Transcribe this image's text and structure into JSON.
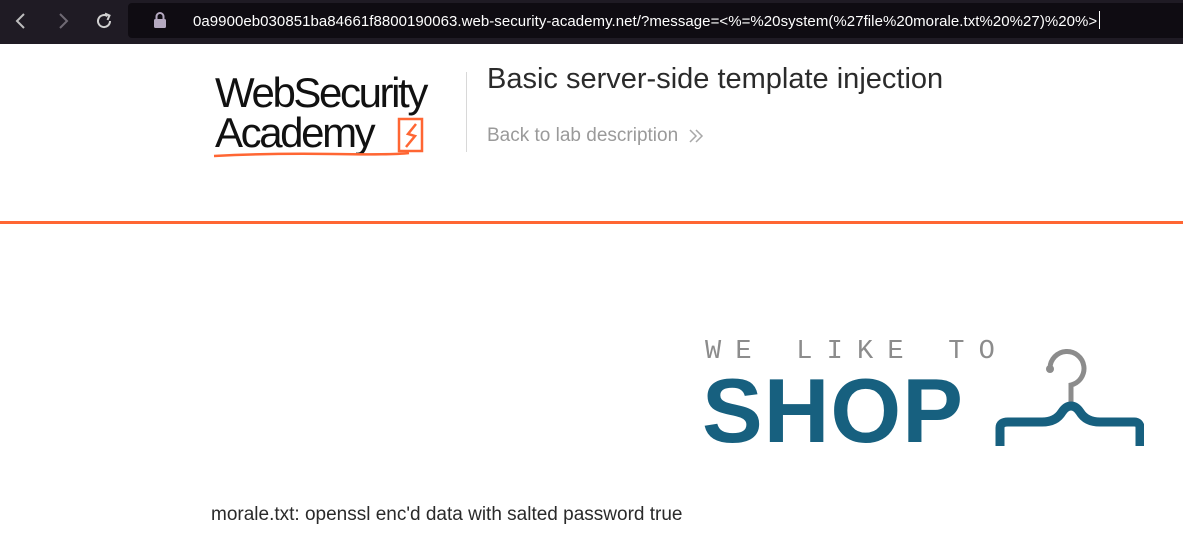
{
  "browser": {
    "url": "0a9900eb030851ba84661f8800190063.web-security-academy.net/?message=<%=%20system(%27file%20morale.txt%20%27)%20%>",
    "back_icon": "chevron-left-icon",
    "forward_icon": "chevron-right-icon",
    "reload_icon": "reload-icon",
    "lock_icon": "lock-icon"
  },
  "academy": {
    "logo_line1": "WebSecurity",
    "logo_line2": "Academy",
    "lab_title": "Basic server-side template injection",
    "back_link": "Back to lab description",
    "accent_color": "#ff6633"
  },
  "shop": {
    "tagline": "WE LIKE TO",
    "name": "SHOP",
    "brand_color": "#17607f",
    "icon": "hanger-icon"
  },
  "main": {
    "message": "morale.txt: openssl enc'd data with salted password true"
  }
}
